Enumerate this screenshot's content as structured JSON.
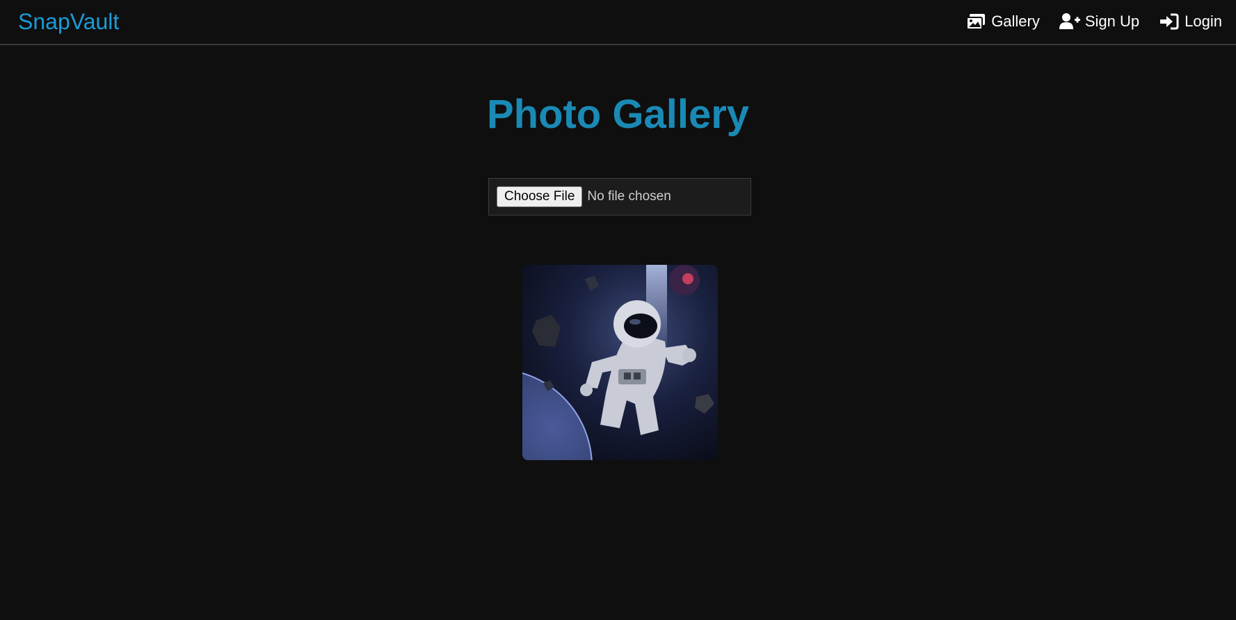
{
  "app": {
    "brand": "SnapVault"
  },
  "nav": {
    "items": [
      {
        "label": "Gallery",
        "icon": "images-icon"
      },
      {
        "label": "Sign Up",
        "icon": "user-plus-icon"
      },
      {
        "label": "Login",
        "icon": "sign-in-icon"
      }
    ]
  },
  "main": {
    "title": "Photo Gallery",
    "upload": {
      "button_label": "Choose File",
      "status": "No file chosen"
    },
    "photos": [
      {
        "subject": "astronaut floating in space",
        "icon": "photo-thumbnail"
      }
    ]
  },
  "colors": {
    "background": "#0f0f0f",
    "brand": "#1a9bd7",
    "title": "#1a8ab5",
    "nav_text": "#ffffff"
  }
}
